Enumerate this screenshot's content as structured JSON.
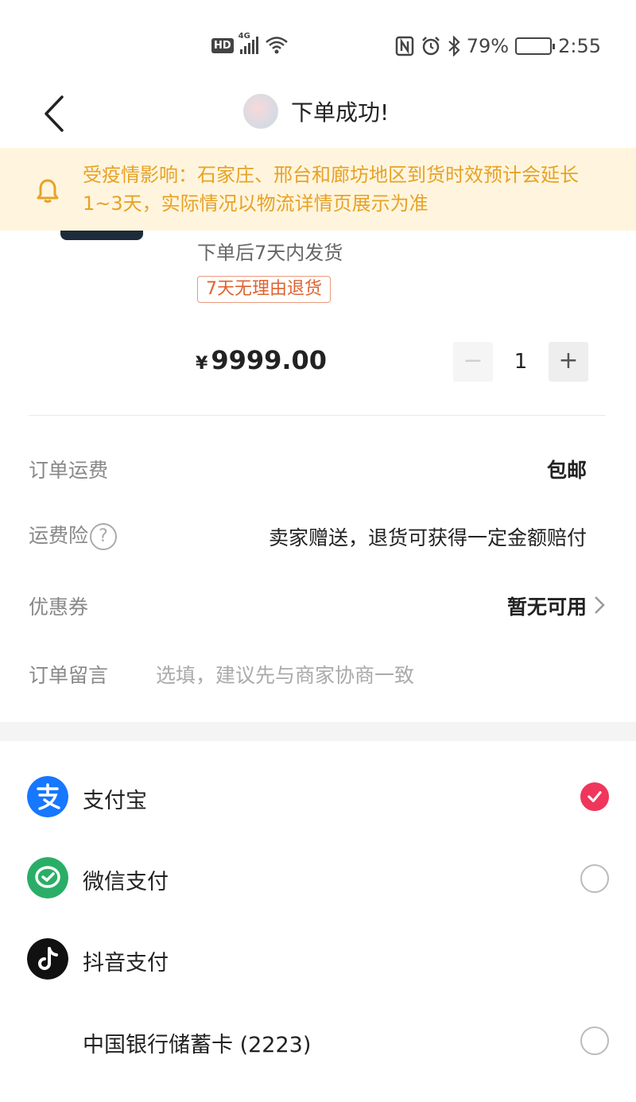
{
  "status_bar": {
    "hd": "HD",
    "network": "4G",
    "battery": "79%",
    "battery_level": 0.79,
    "time": "2:55"
  },
  "header": {
    "title": "下单成功!"
  },
  "notice": {
    "text": "受疫情影响：石家庄、邢台和廊坊地区到货时效预计会延长1~3天，实际情况以物流详情页展示为准",
    "color": "#e7a226",
    "background": "#fff5de"
  },
  "product": {
    "shipping": "下单后7天内发货",
    "return_tag": "7天无理由退货",
    "currency": "¥",
    "price": "9999.00",
    "quantity": "1",
    "minus": "−",
    "plus": "+"
  },
  "order": {
    "freight_label": "订单运费",
    "freight_value": "包邮",
    "insurance_label": "运费险",
    "insurance_help": "?",
    "insurance_value": "卖家赠送，退货可获得一定金额赔付",
    "coupon_label": "优惠券",
    "coupon_value": "暂无可用",
    "note_label": "订单留言",
    "note_placeholder": "选填，建议先与商家协商一致"
  },
  "payment": {
    "selected": "alipay",
    "accent": "#f0365b",
    "methods": [
      {
        "id": "alipay",
        "label": "支付宝",
        "icon": "alipay-icon",
        "color": "#1677ff"
      },
      {
        "id": "wechat",
        "label": "微信支付",
        "icon": "wechat-pay-icon",
        "color": "#2aae67"
      },
      {
        "id": "douyin",
        "label": "抖音支付",
        "icon": "douyin-icon",
        "color": "#111111"
      },
      {
        "id": "boc",
        "label": "中国银行储蓄卡 (2223)"
      }
    ]
  }
}
